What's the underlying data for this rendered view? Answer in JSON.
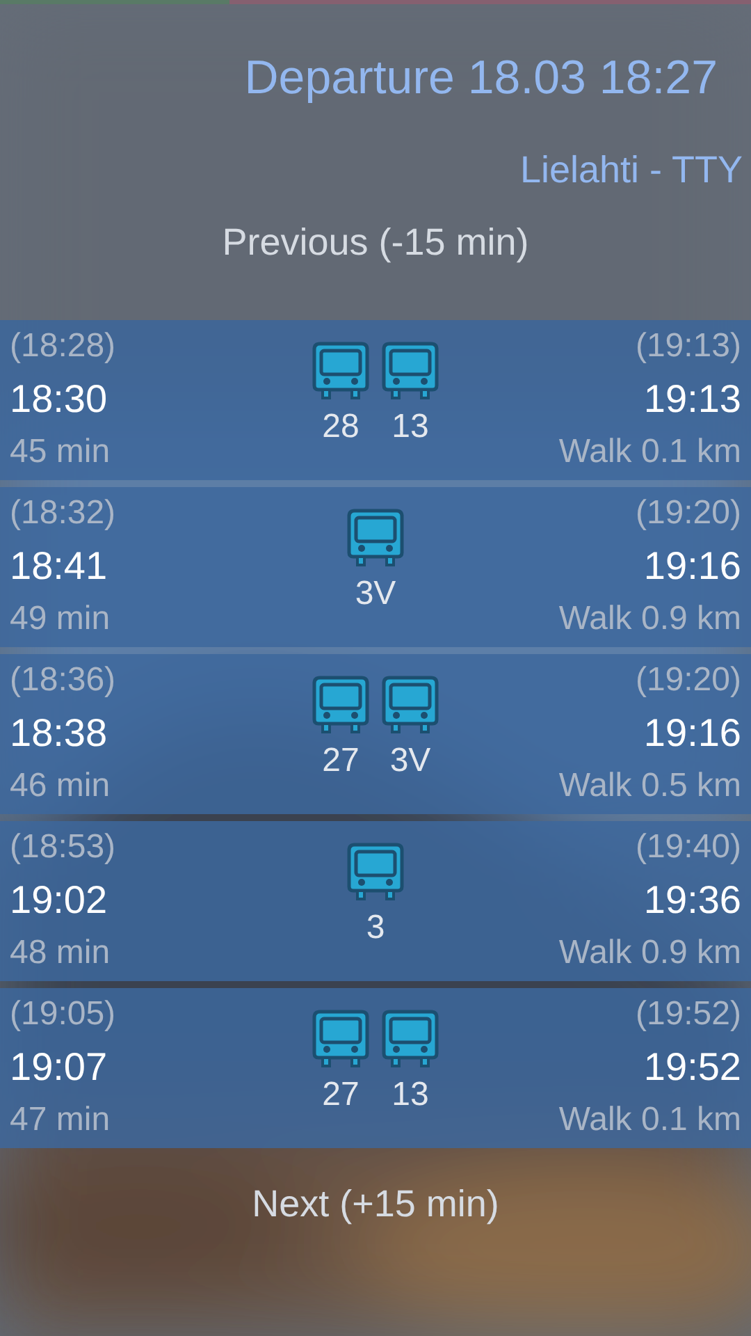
{
  "header": {
    "title": "Departure 18.03 18:27",
    "route": "Lielahti - TTY"
  },
  "previous_button": "Previous (-15 min)",
  "routes": [
    {
      "planned_departure": "(18:28)",
      "departure": "18:30",
      "duration": "45 min",
      "lines": [
        "28",
        "13"
      ],
      "planned_arrival": "(19:13)",
      "arrival": "19:13",
      "walk": "Walk 0.1 km"
    },
    {
      "planned_departure": "(18:32)",
      "departure": "18:41",
      "duration": "49 min",
      "lines": [
        "3V"
      ],
      "planned_arrival": "(19:20)",
      "arrival": "19:16",
      "walk": "Walk 0.9 km"
    },
    {
      "planned_departure": "(18:36)",
      "departure": "18:38",
      "duration": "46 min",
      "lines": [
        "27",
        "3V"
      ],
      "planned_arrival": "(19:20)",
      "arrival": "19:16",
      "walk": "Walk 0.5 km"
    },
    {
      "planned_departure": "(18:53)",
      "departure": "19:02",
      "duration": "48 min",
      "lines": [
        "3"
      ],
      "planned_arrival": "(19:40)",
      "arrival": "19:36",
      "walk": "Walk 0.9 km"
    },
    {
      "planned_departure": "(19:05)",
      "departure": "19:07",
      "duration": "47 min",
      "lines": [
        "27",
        "13"
      ],
      "planned_arrival": "(19:52)",
      "arrival": "19:52",
      "walk": "Walk 0.1 km"
    }
  ],
  "next_button": "Next (+15 min)"
}
